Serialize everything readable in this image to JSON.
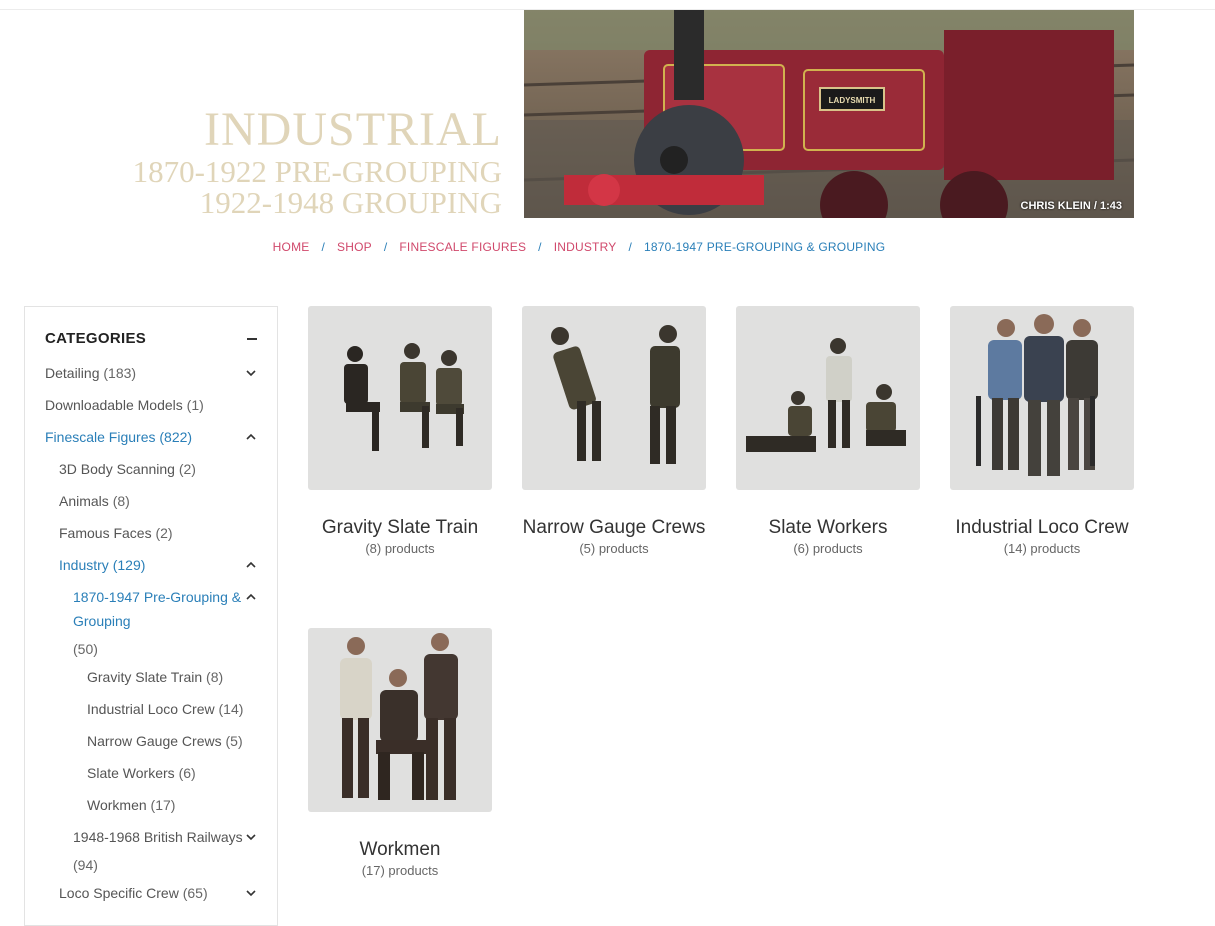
{
  "hero": {
    "title": "INDUSTRIAL",
    "line2": "1870-1922 PRE-GROUPING",
    "line3": "1922-1948 GROUPING",
    "credit": "CHRIS KLEIN / 1:43",
    "loco_plate": "LADYSMITH"
  },
  "breadcrumb": [
    "HOME",
    "SHOP",
    "FINESCALE FIGURES",
    "INDUSTRY",
    "1870-1947 PRE-GROUPING & GROUPING"
  ],
  "sidebar": {
    "title": "CATEGORIES",
    "items": [
      {
        "label": "Detailing",
        "count": "(183)"
      },
      {
        "label": "Downloadable Models",
        "count": "(1)"
      },
      {
        "label": "Finescale Figures",
        "count": "(822)"
      },
      {
        "label": "3D Body Scanning",
        "count": "(2)"
      },
      {
        "label": "Animals",
        "count": "(8)"
      },
      {
        "label": "Famous Faces",
        "count": "(2)"
      },
      {
        "label": "Industry",
        "count": "(129)"
      },
      {
        "label": "1870-1947 Pre-Grouping &",
        "label2": "Grouping",
        "count": "(50)"
      },
      {
        "label": "Gravity Slate Train",
        "count": "(8)"
      },
      {
        "label": "Industrial Loco Crew",
        "count": "(14)"
      },
      {
        "label": "Narrow Gauge Crews",
        "count": "(5)"
      },
      {
        "label": "Slate Workers",
        "count": "(6)"
      },
      {
        "label": "Workmen",
        "count": "(17)"
      },
      {
        "label": "1948-1968 British Railways",
        "count": "(94)"
      },
      {
        "label": "Loco Specific Crew",
        "count": "(65)"
      }
    ]
  },
  "products": [
    {
      "name": "Gravity Slate Train",
      "count": "(8) products"
    },
    {
      "name": "Narrow Gauge Crews",
      "count": "(5) products"
    },
    {
      "name": "Slate Workers",
      "count": "(6) products"
    },
    {
      "name": "Industrial Loco Crew",
      "count": "(14) products"
    },
    {
      "name": "Workmen",
      "count": "(17) products"
    }
  ],
  "colors": {
    "accent_link": "#2a7fb8",
    "breadcrumb_link": "#d0486b",
    "hero_text": "#e0d5b9"
  }
}
